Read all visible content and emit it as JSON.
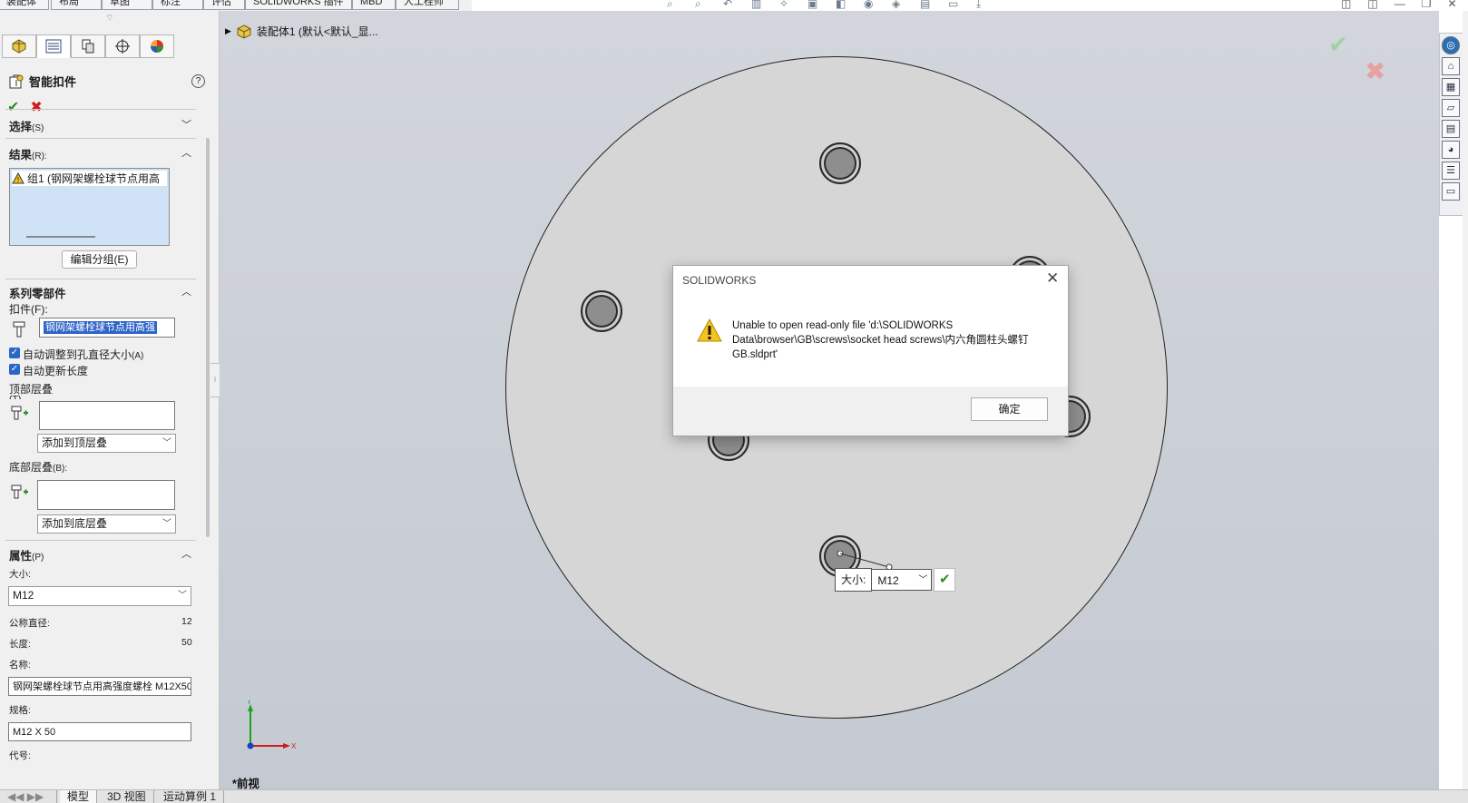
{
  "ribbon_tabs": [
    "装配体",
    "布局",
    "草图",
    "标注",
    "评估",
    "SOLIDWORKS 插件",
    "MBD",
    "人工桂师"
  ],
  "tree": {
    "root_label": "装配体1  (默认<默认_显..."
  },
  "property_manager": {
    "title": "智能扣件",
    "help": "?",
    "sections": {
      "selection": {
        "title": "选择",
        "key": "(S)"
      },
      "results": {
        "title": "结果",
        "key": "(R):",
        "items": [
          "组1 (钢网架螺栓球节点用高"
        ],
        "edit_group_button": "编辑分组(E)"
      },
      "series": {
        "title": "系列零部件",
        "fastener_label": "扣件(F):",
        "fastener_value": "钢网架螺栓球节点用高强",
        "auto_size_label": "自动调整到孔直径大小",
        "auto_size_key": "(A)",
        "auto_length_label": "自动更新长度",
        "top_stack_label": "顶部层叠",
        "top_stack_key": "(T)",
        "top_stack_combo": "添加到顶层叠",
        "bottom_stack_label": "底部层叠",
        "bottom_stack_key": "(B):",
        "bottom_stack_combo": "添加到底层叠"
      },
      "properties": {
        "title": "属性",
        "key": "(P)",
        "size_label": "大小:",
        "size_value": "M12",
        "nominal_label": "公称直径:",
        "nominal_value": "12",
        "length_label": "长度:",
        "length_value": "50",
        "name_label": "名称:",
        "name_value": "钢网架螺栓球节点用高强度螺栓 M12X50",
        "spec_label": "规格:",
        "spec_value": "M12 X 50",
        "code_label": "代号:"
      }
    }
  },
  "bottom_tabs": [
    "模型",
    "3D 视图",
    "运动算例 1"
  ],
  "viewport": {
    "view_label": "*前视",
    "triad": {
      "x": "X",
      "y": "Y"
    },
    "size_popup": {
      "label": "大小:",
      "value": "M12"
    }
  },
  "dialog": {
    "title": "SOLIDWORKS",
    "message_line1": "Unable to open read-only file 'd:\\SOLIDWORKS",
    "message_line2": "Data\\browser\\GB\\screws\\socket head screws\\内六角圆柱头螺钉",
    "message_line3": "GB.sldprt'",
    "ok_button": "确定",
    "close_symbol": "✕"
  },
  "colors": {
    "accent": "#2f64c8",
    "ok_green": "#2a8f2a",
    "cancel_red": "#d11a1a",
    "warn_yellow": "#f6c21c"
  }
}
